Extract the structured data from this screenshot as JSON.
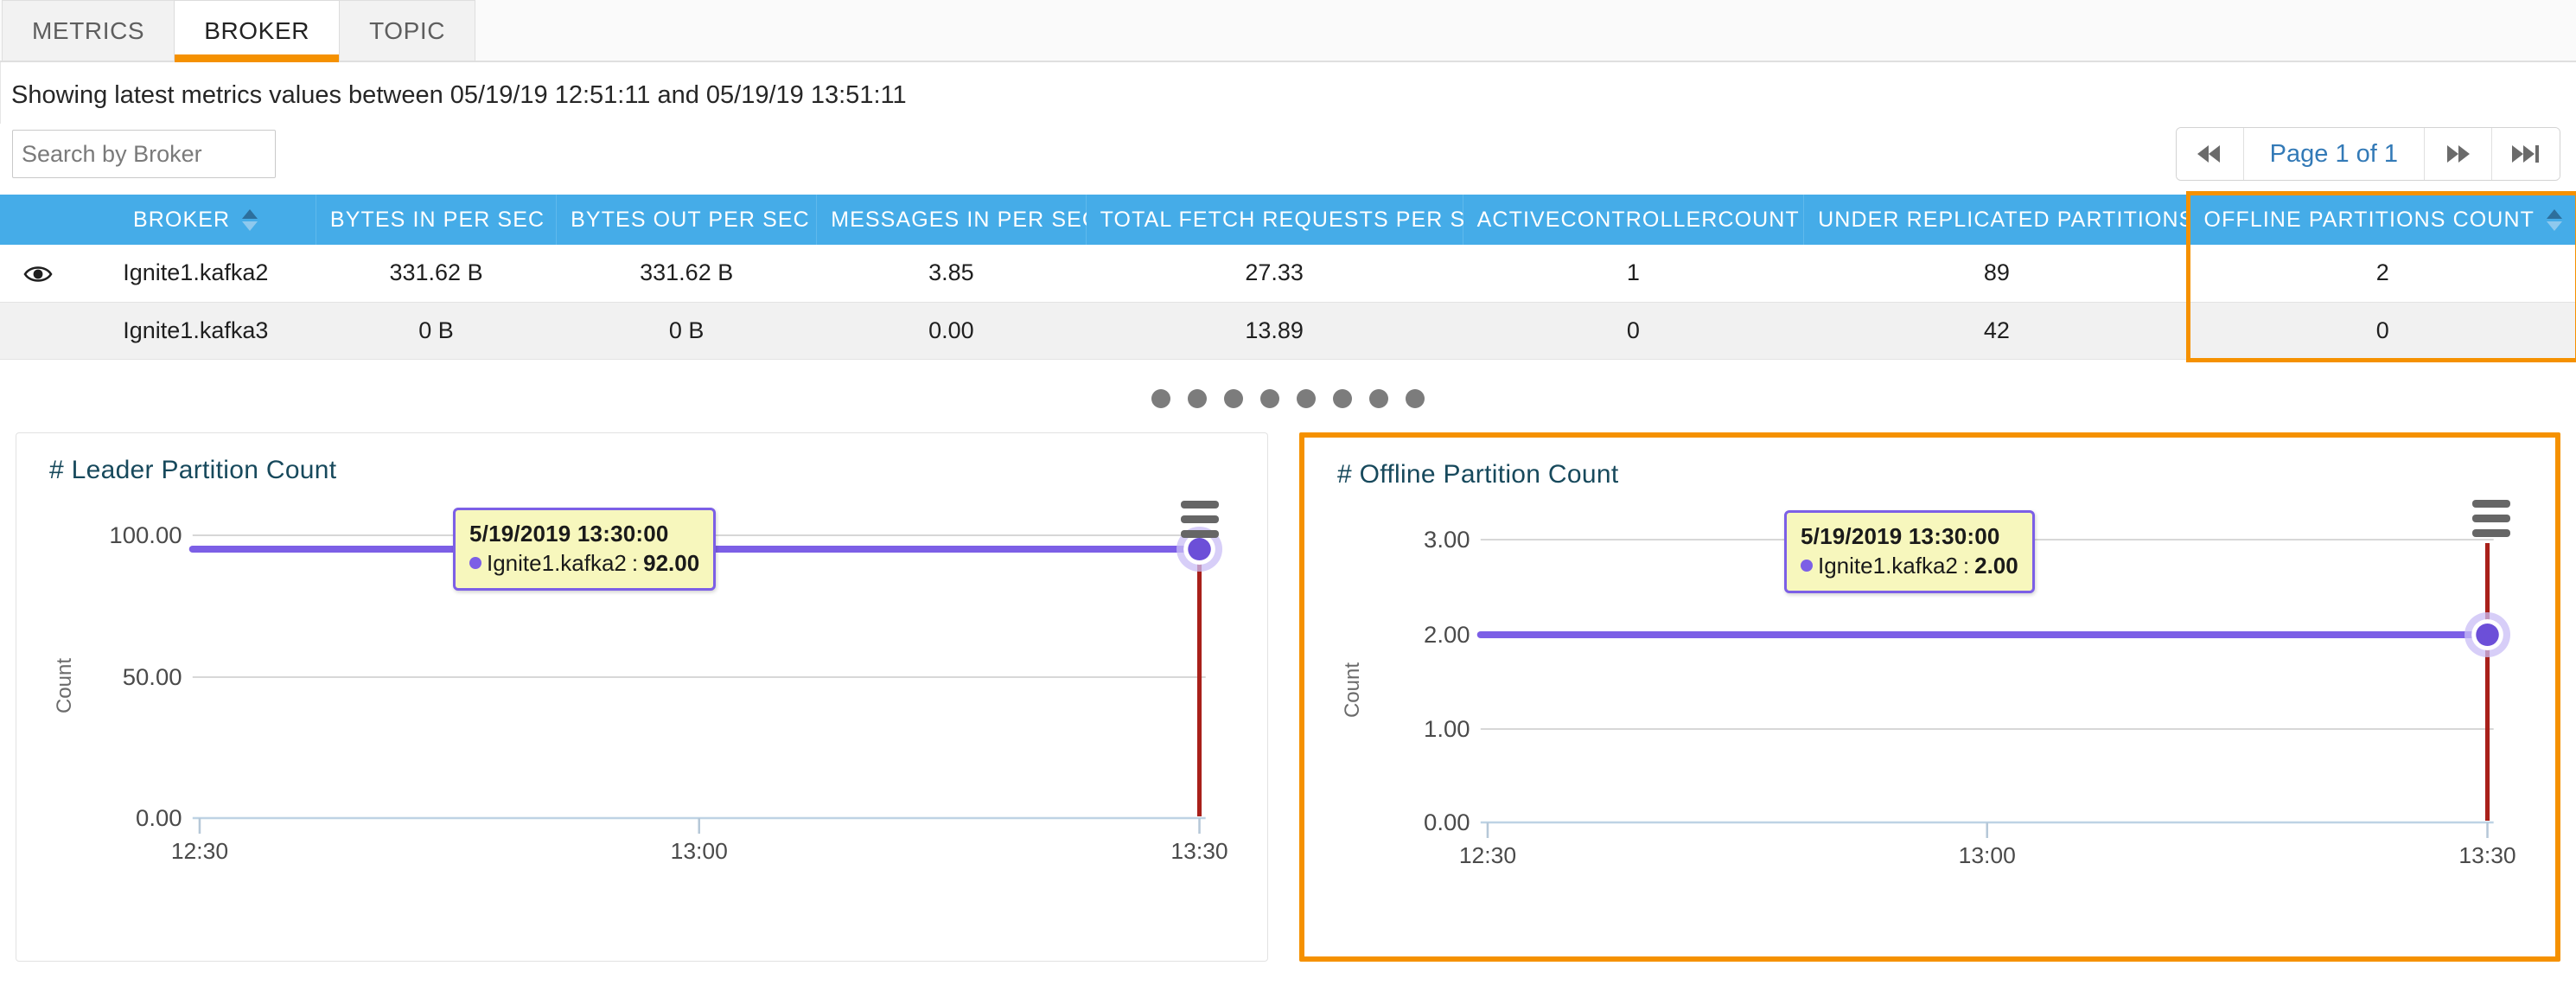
{
  "tabs": [
    {
      "label": "METRICS",
      "active": false
    },
    {
      "label": "BROKER",
      "active": true
    },
    {
      "label": "TOPIC",
      "active": false
    }
  ],
  "info_line": "Showing latest metrics values between 05/19/19 12:51:11 and 05/19/19 13:51:11",
  "search": {
    "placeholder": "Search by Broker",
    "value": ""
  },
  "pagination": {
    "first_label": "◀◀",
    "page_label": "Page 1 of 1",
    "next_label": "▶▶",
    "last_label": "▶▶|"
  },
  "table": {
    "columns": [
      "BROKER",
      "BYTES IN PER SEC",
      "BYTES OUT PER SEC",
      "MESSAGES IN PER SEC",
      "TOTAL FETCH REQUESTS PER SEC",
      "ACTIVECONTROLLERCOUNT",
      "UNDER REPLICATED PARTITIONS",
      "OFFLINE PARTITIONS COUNT"
    ],
    "highlighted_column": "OFFLINE PARTITIONS COUNT",
    "rows": [
      {
        "has_eye": true,
        "cells": [
          "Ignite1.kafka2",
          "331.62 B",
          "331.62 B",
          "3.85",
          "27.33",
          "1",
          "89",
          "2"
        ]
      },
      {
        "has_eye": false,
        "cells": [
          "Ignite1.kafka3",
          "0 B",
          "0 B",
          "0.00",
          "13.89",
          "0",
          "42",
          "0"
        ]
      }
    ]
  },
  "carousel": {
    "dot_count": 8,
    "active_index": 0
  },
  "colors": {
    "accent_orange": "#f59100",
    "header_blue": "#45ace8",
    "series_purple": "#7c5fe6",
    "crosshair_red": "#a8201a",
    "title_teal": "#17495c",
    "page_link_blue": "#337ab7"
  },
  "chart_data": [
    {
      "type": "line",
      "title": "# Leader Partition Count",
      "xlabel": "",
      "ylabel": "Count",
      "x_ticks": [
        "12:30",
        "13:00",
        "13:30"
      ],
      "y_ticks": [
        "0.00",
        "50.00",
        "100.00"
      ],
      "ylim": [
        0,
        112
      ],
      "grid": true,
      "legend": "none",
      "series": [
        {
          "name": "Ignite1.kafka2",
          "color": "#7c5fe6",
          "values": [
            92.0,
            92.0,
            92.0
          ]
        }
      ],
      "tooltip": {
        "time": "5/19/2019 13:30:00",
        "series_name": "Ignite1.kafka2",
        "value": "92.00"
      },
      "crosshair_x": "13:30",
      "menu_icon": "hamburger-icon"
    },
    {
      "type": "line",
      "title": "# Offline Partition Count",
      "xlabel": "",
      "ylabel": "Count",
      "x_ticks": [
        "12:30",
        "13:00",
        "13:30"
      ],
      "y_ticks": [
        "0.00",
        "1.00",
        "2.00",
        "3.00"
      ],
      "ylim": [
        0,
        3.35
      ],
      "grid": true,
      "legend": "none",
      "highlighted": true,
      "series": [
        {
          "name": "Ignite1.kafka2",
          "color": "#7c5fe6",
          "values": [
            2.0,
            2.0,
            2.0
          ]
        }
      ],
      "tooltip": {
        "time": "5/19/2019 13:30:00",
        "series_name": "Ignite1.kafka2",
        "value": "2.00"
      },
      "crosshair_x": "13:30",
      "menu_icon": "hamburger-icon"
    }
  ]
}
